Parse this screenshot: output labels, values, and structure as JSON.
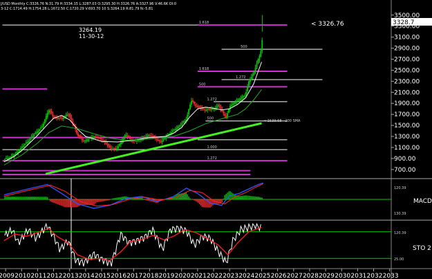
{
  "header": {
    "line1": "J/USD Monthly C:3326.76 N:31.79 H:3334.15 L:3287.03 O:3295.30 H:3326.76 A:3327.96 V:46.6K OI:0",
    "line2": "3-12 C:1714.49 H:1754.28 L:1672.50 C:1720.29 V:693.70 10 S:3264.19 R:81.79 N:-5.81"
  },
  "annotation": {
    "price": "3264.19",
    "date": "11-30-12"
  },
  "last_price_label": "< 3326.76",
  "last_price_box": "3328.7",
  "sma_label": "< 1539.68 - 200 SMA",
  "fib_labels": [
    "1.618",
    "500",
    "1.618",
    "1.272",
    "500",
    "1.272",
    "500",
    "1.000",
    "1.272"
  ],
  "macd_label": "MACD (",
  "sto_label": "STO 2",
  "indicator_ticks": [
    "120.39",
    "130.39",
    "120.39",
    "25.00"
  ],
  "colors": {
    "background": "#000000",
    "candle_up": "#00cc00",
    "candle_down": "#ff3030",
    "fib_lines": "#cc33cc",
    "sma200": "#44ee22",
    "ma_white": "#ffffff",
    "ma_green": "#22aa22",
    "macd_line": "#3355ff",
    "signal_line": "#ff2020",
    "stoch_k": "#ffffff",
    "stoch_d": "#ff2020"
  },
  "chart_data": [
    {
      "type": "candlestick",
      "title": "",
      "xlabel": "",
      "ylabel": "",
      "x_ticks": [
        "2009",
        "2010",
        "2011",
        "2012",
        "2013",
        "2014",
        "2015",
        "2016",
        "2017",
        "2018",
        "2019",
        "2020",
        "2021",
        "2022",
        "2023",
        "2024",
        "2025",
        "2026",
        "2027",
        "2028",
        "2029",
        "2030",
        "2031",
        "2032",
        "2033"
      ],
      "y_ticks": [
        "3500.00",
        "3300.00",
        "3100.00",
        "2900.00",
        "2700.00",
        "2500.00",
        "2300.00",
        "2100.00",
        "1900.00",
        "1700.00",
        "1500.00",
        "1300.00",
        "1100.00",
        "900.00",
        "700.00"
      ],
      "ylim": [
        560,
        3560
      ],
      "grid": false,
      "series": [
        {
          "name": "",
          "kind": "close",
          "x": [
            2008.9,
            2009.5,
            2010.0,
            2010.5,
            2011.0,
            2011.3,
            2011.67,
            2012.0,
            2012.5,
            2012.9,
            2013.3,
            2013.5,
            2013.9,
            2014.5,
            2015.0,
            2015.5,
            2015.9,
            2016.5,
            2017.0,
            2017.5,
            2018.0,
            2018.7,
            2019.0,
            2019.5,
            2020.0,
            2020.3,
            2020.6,
            2021.0,
            2021.5,
            2022.0,
            2022.3,
            2022.8,
            2023.0,
            2023.5,
            2024.0,
            2024.2,
            2024.5,
            2024.8,
            2025.0,
            2025.1
          ],
          "y": [
            880,
            950,
            1100,
            1250,
            1400,
            1480,
            1780,
            1650,
            1620,
            1710,
            1480,
            1320,
            1210,
            1300,
            1250,
            1100,
            1060,
            1330,
            1200,
            1260,
            1330,
            1200,
            1290,
            1410,
            1520,
            1620,
            1950,
            1830,
            1780,
            1800,
            1860,
            1640,
            1850,
            1950,
            2060,
            2300,
            2450,
            2700,
            2900,
            3326.76
          ]
        },
        {
          "name": "",
          "kind": "ma",
          "x": [
            2008.9,
            2009.5,
            2010.0,
            2010.5,
            2011.0,
            2011.5,
            2012.0,
            2012.5,
            2013.0,
            2013.5,
            2014.0,
            2015.0,
            2016.0,
            2017.0,
            2018.0,
            2019.0,
            2019.5,
            2020.0,
            2020.5,
            2021.0,
            2021.5,
            2022.0,
            2022.5,
            2023.0,
            2023.5,
            2024.0,
            2024.5,
            2025.0
          ],
          "y": [
            840,
            930,
            1040,
            1180,
            1320,
            1480,
            1630,
            1680,
            1600,
            1430,
            1300,
            1210,
            1200,
            1230,
            1280,
            1300,
            1360,
            1460,
            1650,
            1800,
            1830,
            1810,
            1780,
            1800,
            1880,
            2000,
            2250,
            2650
          ]
        },
        {
          "name": "",
          "kind": "ma",
          "x": [
            2008.9,
            2010.0,
            2011.0,
            2011.7,
            2012.5,
            2013.5,
            2014.5,
            2015.5,
            2016.5,
            2017.5,
            2018.5,
            2019.5,
            2020.5,
            2021.5,
            2022.5,
            2023.5,
            2024.0,
            2024.5,
            2025.0
          ],
          "y": [
            780,
            960,
            1180,
            1370,
            1490,
            1440,
            1350,
            1270,
            1230,
            1240,
            1270,
            1300,
            1400,
            1530,
            1620,
            1700,
            1800,
            1960,
            2150
          ]
        },
        {
          "name": "",
          "kind": "sma200",
          "x": [
            2011.5,
            2025.0
          ],
          "y": [
            620,
            1539.68
          ]
        }
      ],
      "horizontal_levels": [
        {
          "value": 3320,
          "x_from": 2008.8,
          "x_to": 2025.0,
          "color": "white"
        },
        {
          "value": 3320,
          "x_from": 2021.0,
          "x_to": 2026.6,
          "color": "magenta"
        },
        {
          "value": 2880,
          "x_from": 2022.5,
          "x_to": 2028.8,
          "color": "white"
        },
        {
          "value": 2480,
          "x_from": 2021.0,
          "x_to": 2026.6,
          "color": "magenta"
        },
        {
          "value": 2330,
          "x_from": 2022.5,
          "x_to": 2028.8,
          "color": "white"
        },
        {
          "value": 2200,
          "x_from": 2021.0,
          "x_to": 2026.6,
          "color": "magenta"
        },
        {
          "value": 1930,
          "x_from": 2022.0,
          "x_to": 2026.6,
          "color": "white"
        },
        {
          "value": 1580,
          "x_from": 2021.5,
          "x_to": 2026.6,
          "color": "white"
        },
        {
          "value": 1280,
          "x_from": 2008.8,
          "x_to": 2021.0,
          "color": "magenta"
        },
        {
          "value": 1240,
          "x_from": 2021.0,
          "x_to": 2026.6,
          "color": "white"
        },
        {
          "value": 1060,
          "x_from": 2008.8,
          "x_to": 2026.6,
          "color": "white"
        },
        {
          "value": 860,
          "x_from": 2008.8,
          "x_to": 2026.6,
          "color": "magenta"
        },
        {
          "value": 2160,
          "x_from": 2008.8,
          "x_to": 2011.6,
          "color": "magenta"
        },
        {
          "value": 680,
          "x_from": 2008.8,
          "x_to": 2024.3,
          "color": "magenta"
        },
        {
          "value": 610,
          "x_from": 2008.8,
          "x_to": 2024.3,
          "color": "magenta"
        }
      ]
    },
    {
      "type": "line",
      "title": "",
      "series": [
        {
          "name": "",
          "kind": "macd",
          "x": [
            2008.9,
            2010.0,
            2011.0,
            2011.6,
            2012.5,
            2013.5,
            2014.5,
            2015.5,
            2016.5,
            2017.5,
            2018.5,
            2019.5,
            2020.3,
            2021.0,
            2021.8,
            2022.5,
            2023.0,
            2023.6,
            2024.2,
            2024.8,
            2025.1
          ],
          "y": [
            30,
            60,
            85,
            100,
            40,
            -30,
            -60,
            -40,
            5,
            20,
            -15,
            20,
            75,
            40,
            -25,
            -40,
            25,
            40,
            70,
            100,
            110
          ]
        },
        {
          "name": "",
          "kind": "signal",
          "x": [
            2008.9,
            2010.0,
            2011.0,
            2011.8,
            2012.7,
            2013.7,
            2014.7,
            2015.7,
            2016.7,
            2017.7,
            2018.7,
            2019.7,
            2020.5,
            2021.3,
            2022.0,
            2022.7,
            2023.3,
            2024.0,
            2024.7,
            2025.1
          ],
          "y": [
            20,
            50,
            75,
            95,
            55,
            -15,
            -45,
            -35,
            0,
            15,
            -5,
            15,
            60,
            45,
            -10,
            -30,
            15,
            45,
            85,
            105
          ]
        }
      ]
    },
    {
      "type": "line",
      "title": "",
      "ylim": [
        0,
        100
      ],
      "series": [
        {
          "name": "",
          "kind": "stoch_k",
          "x": [
            2008.9,
            2009.4,
            2009.8,
            2010.4,
            2010.9,
            2011.6,
            2012.0,
            2012.4,
            2012.9,
            2013.4,
            2013.9,
            2014.5,
            2015.0,
            2015.6,
            2016.2,
            2016.7,
            2017.2,
            2017.7,
            2018.2,
            2018.8,
            2019.3,
            2019.8,
            2020.3,
            2020.8,
            2021.3,
            2021.8,
            2022.3,
            2022.8,
            2023.2,
            2023.7,
            2024.2,
            2024.6,
            2025.0
          ],
          "y": [
            70,
            85,
            55,
            85,
            65,
            95,
            70,
            40,
            60,
            15,
            10,
            30,
            18,
            8,
            75,
            55,
            60,
            68,
            85,
            40,
            85,
            88,
            82,
            50,
            70,
            65,
            35,
            10,
            60,
            85,
            90,
            95,
            88
          ]
        },
        {
          "name": "",
          "kind": "stoch_d",
          "x": [
            2008.9,
            2009.6,
            2010.3,
            2011.0,
            2011.7,
            2012.2,
            2012.9,
            2013.5,
            2014.2,
            2014.9,
            2015.5,
            2016.2,
            2016.8,
            2017.5,
            2018.2,
            2018.9,
            2019.5,
            2020.2,
            2020.9,
            2021.6,
            2022.3,
            2022.9,
            2023.5,
            2024.2,
            2024.8,
            2025.0
          ],
          "y": [
            60,
            75,
            70,
            78,
            88,
            70,
            55,
            28,
            18,
            20,
            15,
            35,
            58,
            62,
            72,
            62,
            70,
            85,
            78,
            65,
            50,
            28,
            55,
            80,
            88,
            90
          ]
        }
      ],
      "levels": [
        80,
        20
      ]
    }
  ]
}
